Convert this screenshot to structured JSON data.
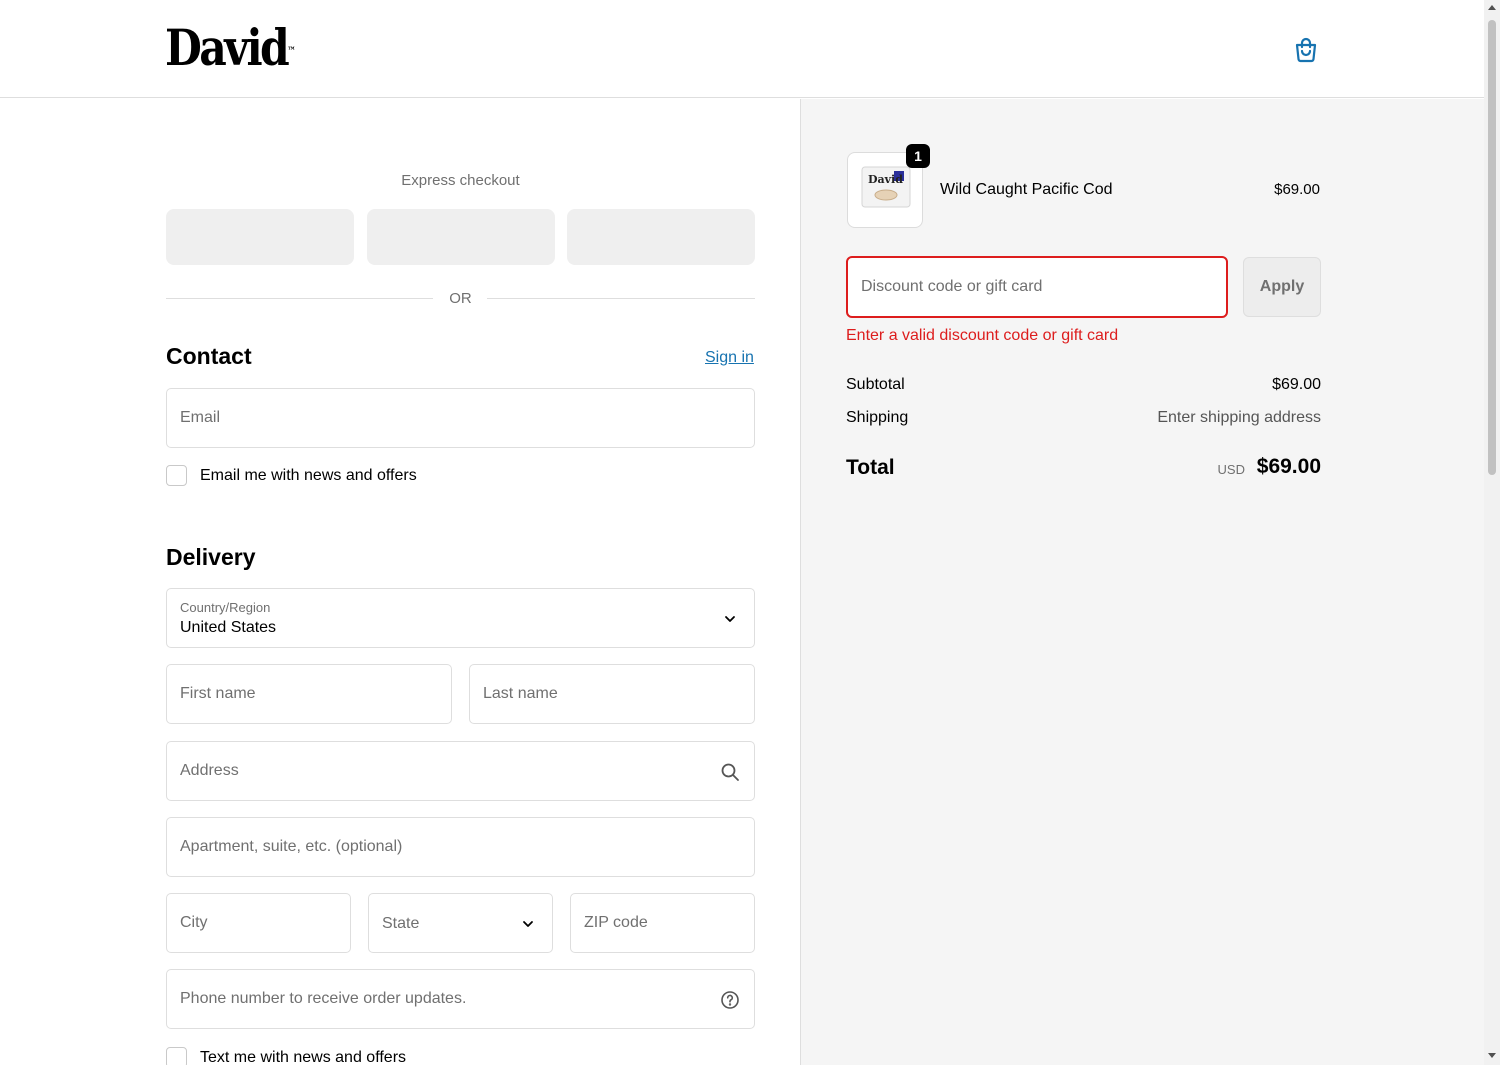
{
  "brand": {
    "logo_text": "David",
    "trademark": "™"
  },
  "header": {
    "cart_icon": "shopping-bag-icon"
  },
  "express": {
    "title": "Express checkout",
    "divider": "OR"
  },
  "contact": {
    "title": "Contact",
    "sign_in": "Sign in",
    "email_placeholder": "Email",
    "newsletter_label": "Email me with news and offers"
  },
  "delivery": {
    "title": "Delivery",
    "country_label": "Country/Region",
    "country_value": "United States",
    "first_name_placeholder": "First name",
    "last_name_placeholder": "Last name",
    "address_placeholder": "Address",
    "apartment_placeholder": "Apartment, suite, etc. (optional)",
    "city_placeholder": "City",
    "state_placeholder": "State",
    "zip_placeholder": "ZIP code",
    "phone_placeholder": "Phone number to receive order updates.",
    "sms_label": "Text me with news and offers"
  },
  "summary": {
    "product": {
      "name": "Wild Caught Pacific Cod",
      "price": "$69.00",
      "quantity": "1",
      "thumb_text": "David"
    },
    "discount_placeholder": "Discount code or gift card",
    "apply_label": "Apply",
    "discount_error": "Enter a valid discount code or gift card",
    "subtotal_label": "Subtotal",
    "subtotal_value": "$69.00",
    "shipping_label": "Shipping",
    "shipping_value": "Enter shipping address",
    "total_label": "Total",
    "total_currency": "USD",
    "total_value": "$69.00"
  },
  "colors": {
    "link": "#1773b0",
    "error": "#dd1d1d",
    "summary_bg": "#f5f5f5"
  }
}
